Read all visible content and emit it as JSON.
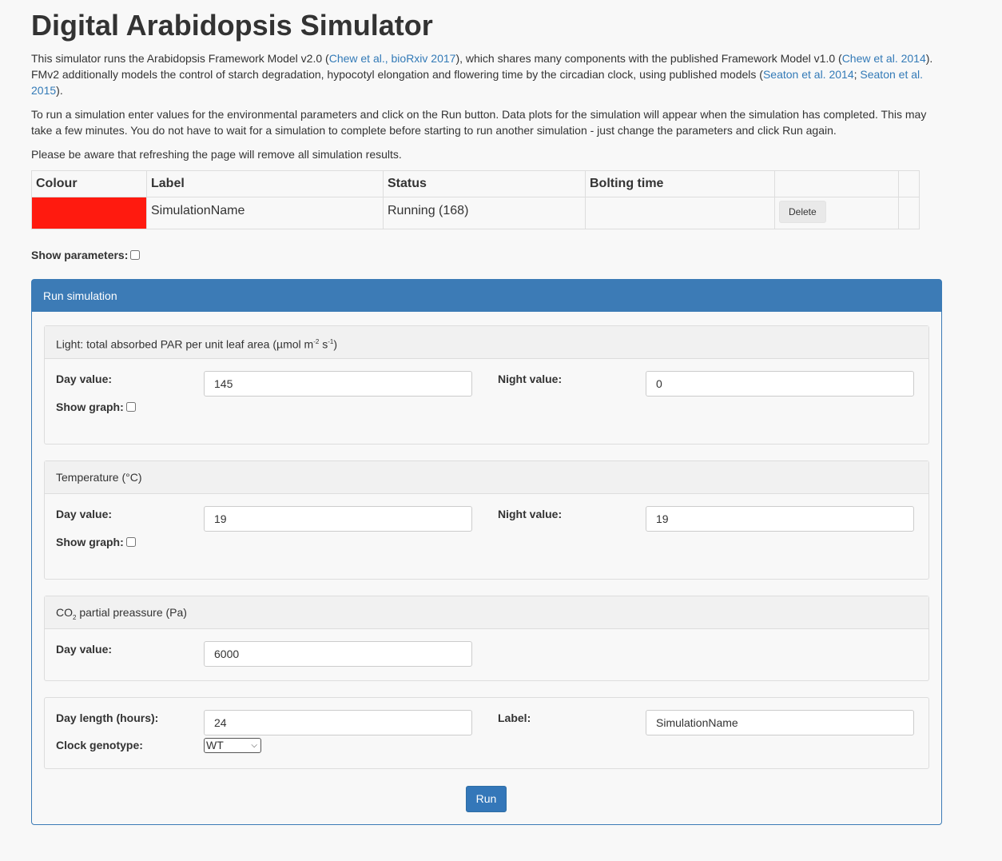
{
  "header": {
    "title": "Digital Arabidopsis Simulator"
  },
  "intro": {
    "p1_a": "This simulator runs the Arabidopsis Framework Model v2.0 (",
    "link1": "Chew et al., bioRxiv 2017",
    "p1_b": "), which shares many components with the published Framework Model v1.0 (",
    "link2": "Chew et al. 2014",
    "p1_c": "). FMv2 additionally models the control of starch degradation, hypocotyl elongation and flowering time by the circadian clock, using published models (",
    "link3": "Seaton et al. 2014",
    "p1_d": "; ",
    "link4": "Seaton et al. 2015",
    "p1_e": ").",
    "p2": "To run a simulation enter values for the environmental parameters and click on the Run button. Data plots for the simulation will appear when the simulation has completed. This may take a few minutes. You do not have to wait for a simulation to complete before starting to run another simulation - just change the parameters and click Run again.",
    "p3": "Please be aware that refreshing the page will remove all simulation results."
  },
  "table": {
    "headers": [
      "Colour",
      "Label",
      "Status",
      "Bolting time",
      "",
      ""
    ],
    "rows": [
      {
        "colour": "#ff1a0f",
        "label": "SimulationName",
        "status": "Running (168)",
        "bolting": "",
        "action": "Delete"
      }
    ]
  },
  "show_params_label": "Show parameters:",
  "panel": {
    "title": "Run simulation",
    "light": {
      "title_a": "Light: total absorbed PAR per unit leaf area (µmol m",
      "sup1": "-2",
      "title_b": " s",
      "sup2": "-1",
      "title_c": ")",
      "day_label": "Day value:",
      "day_value": "145",
      "night_label": "Night value:",
      "night_value": "0",
      "graph_label": "Show graph:"
    },
    "temperature": {
      "title": "Temperature (°C)",
      "day_label": "Day value:",
      "day_value": "19",
      "night_label": "Night value:",
      "night_value": "19",
      "graph_label": "Show graph:"
    },
    "co2": {
      "title_a": "CO",
      "title_sub": "2",
      "title_b": " partial preassure (Pa)",
      "day_label": "Day value:",
      "day_value": "6000"
    },
    "other": {
      "daylength_label": "Day length (hours):",
      "daylength_value": "24",
      "label_label": "Label:",
      "label_value": "SimulationName",
      "genotype_label": "Clock genotype:",
      "genotype_value": "WT"
    },
    "run_label": "Run"
  }
}
